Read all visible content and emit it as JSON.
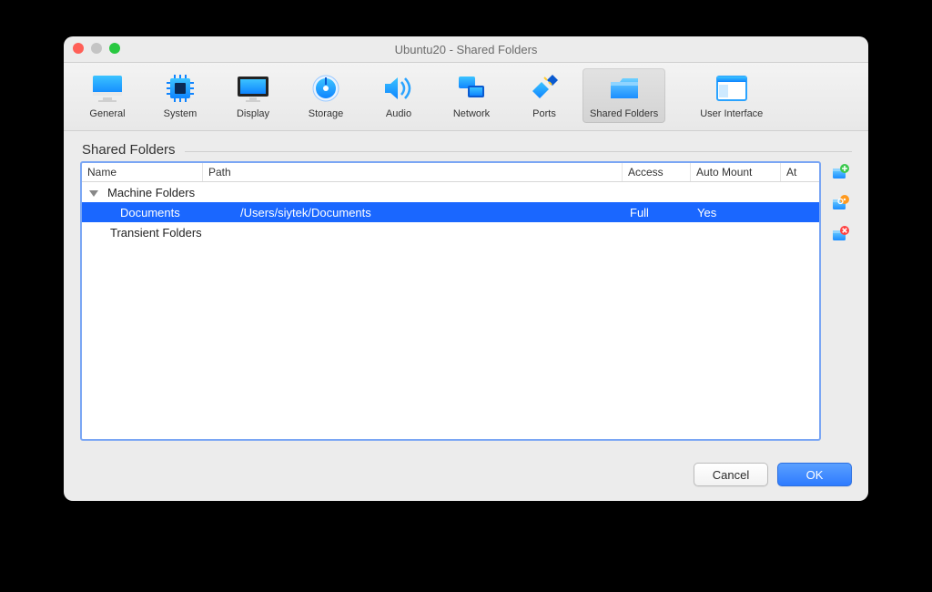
{
  "window": {
    "title": "Ubuntu20 - Shared Folders"
  },
  "toolbar": {
    "tabs": [
      {
        "id": "general",
        "label": "General"
      },
      {
        "id": "system",
        "label": "System"
      },
      {
        "id": "display",
        "label": "Display"
      },
      {
        "id": "storage",
        "label": "Storage"
      },
      {
        "id": "audio",
        "label": "Audio"
      },
      {
        "id": "network",
        "label": "Network"
      },
      {
        "id": "ports",
        "label": "Ports"
      },
      {
        "id": "shared-folders",
        "label": "Shared Folders",
        "active": true
      },
      {
        "id": "user-interface",
        "label": "User Interface"
      }
    ]
  },
  "section": {
    "title": "Shared Folders"
  },
  "table": {
    "columns": [
      "Name",
      "Path",
      "Access",
      "Auto Mount",
      "At"
    ],
    "groups": [
      {
        "label": "Machine Folders",
        "expanded": true,
        "rows": [
          {
            "name": "Documents",
            "path": "/Users/siytek/Documents",
            "access": "Full",
            "auto_mount": "Yes",
            "at": "",
            "selected": true
          }
        ]
      },
      {
        "label": "Transient Folders",
        "expanded": false,
        "rows": []
      }
    ]
  },
  "side_buttons": {
    "add": "add-share",
    "edit": "edit-share",
    "remove": "remove-share"
  },
  "footer": {
    "cancel": "Cancel",
    "ok": "OK"
  }
}
